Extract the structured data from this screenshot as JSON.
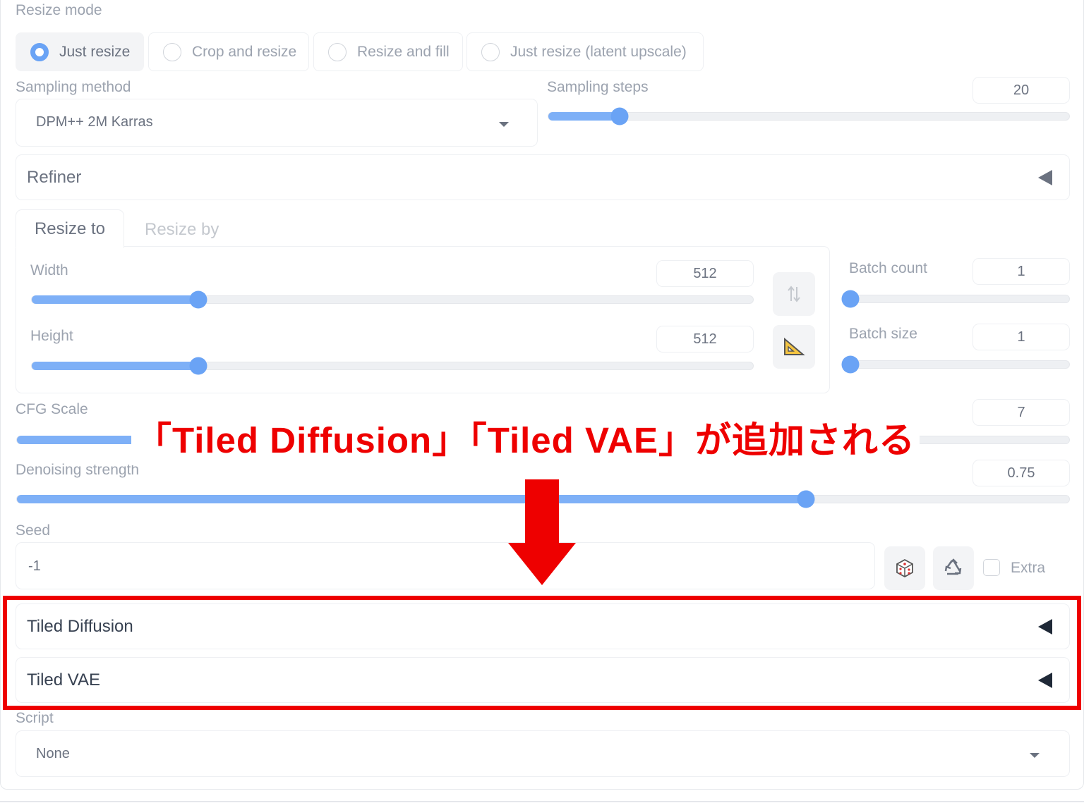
{
  "resize_mode": {
    "label": "Resize mode",
    "options": [
      "Just resize",
      "Crop and resize",
      "Resize and fill",
      "Just resize (latent upscale)"
    ],
    "selected": "Just resize"
  },
  "sampling": {
    "method_label": "Sampling method",
    "method_value": "DPM++ 2M Karras",
    "steps_label": "Sampling steps",
    "steps_value": "20"
  },
  "refiner": {
    "title": "Refiner"
  },
  "tabs": {
    "resize_to": "Resize to",
    "resize_by": "Resize by"
  },
  "dimensions": {
    "width_label": "Width",
    "width_value": "512",
    "height_label": "Height",
    "height_value": "512"
  },
  "batch": {
    "count_label": "Batch count",
    "count_value": "1",
    "size_label": "Batch size",
    "size_value": "1"
  },
  "cfg": {
    "label": "CFG Scale",
    "value": "7"
  },
  "denoising": {
    "label": "Denoising strength",
    "value": "0.75"
  },
  "seed": {
    "label": "Seed",
    "value": "-1",
    "extra_label": "Extra"
  },
  "extensions": {
    "tiled_diffusion": "Tiled Diffusion",
    "tiled_vae": "Tiled VAE"
  },
  "script": {
    "label": "Script",
    "value": "None"
  },
  "annotation": {
    "text": "「Tiled Diffusion」「Tiled VAE」が追加される",
    "color": "#ee0000"
  },
  "slider_levels": {
    "sampling_steps": 0.137,
    "width": 0.231,
    "height": 0.231,
    "batch_count": 0.0,
    "batch_size": 0.0,
    "cfg_scale": 0.2,
    "denoising": 0.75
  },
  "colors": {
    "accent": "#6aa3f5",
    "slider_fill": "#7eb0f7"
  }
}
